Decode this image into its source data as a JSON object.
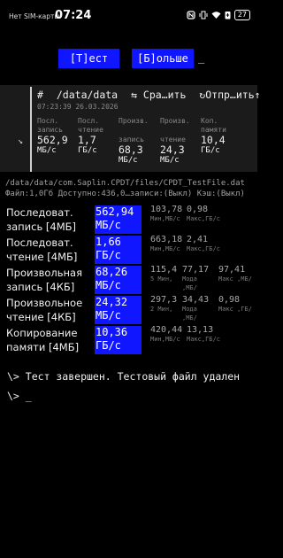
{
  "status": {
    "carrier": "Нет SIM-карты",
    "time": "07:24",
    "icons": [
      "nfc-icon",
      "vibrate-icon",
      "wifi-icon",
      "battery-saver-icon",
      "battery-icon"
    ],
    "battery": "27"
  },
  "buttons": {
    "test": "[Т]ест",
    "more": "[Б]ольше",
    "cursor": "_"
  },
  "panel": {
    "hash": "#",
    "path": "/data/data",
    "compare": "⇆ Сра…ить",
    "send": "↻Отпр…ить↑",
    "timestamp": "07:23:39 26.03.2026",
    "arrow": "↘",
    "stats": [
      {
        "label1": "Посл.",
        "label2": "запись",
        "value": "562,9",
        "unit": "МБ/с"
      },
      {
        "label1": "Посл.",
        "label2": "чтение",
        "value": "1,7",
        "unit": "ГБ/с"
      },
      {
        "label1": "Произв.",
        "label2": "запись",
        "value": "68,3",
        "unit": "МБ/с"
      },
      {
        "label1": "Произв.",
        "label2": "чтение",
        "value": "24,3",
        "unit": "МБ/с"
      },
      {
        "label1": "Коп.",
        "label2": "памяти",
        "value": "10,4",
        "unit": "ГБ/с"
      }
    ]
  },
  "fileinfo": {
    "line1": "/data/data/com.Saplin.CPDT/files/CPDT_TestFile.dat",
    "line2": "Файл:1,0Гб Доступно:436,0…записи:(Выкл) Кэш:(Выкл)"
  },
  "results": [
    {
      "label": "Последоват.\nзапись [4МБ]",
      "value": "562,94",
      "unit": "МБ/с",
      "extra": [
        {
          "v": "103,78",
          "l": "Мин,МБ/с"
        },
        {
          "v": "0,98",
          "l": "Макс,ГБ/с"
        }
      ]
    },
    {
      "label": "Последоват.\nчтение [4МБ]",
      "value": "1,66",
      "unit": "ГБ/с",
      "extra": [
        {
          "v": "663,18",
          "l": "Мин,МБ/с"
        },
        {
          "v": "2,41",
          "l": "Макс,ГБ/с"
        }
      ]
    },
    {
      "label": "Произвольная\nзапись [4КБ]",
      "value": "68,26",
      "unit": "МБ/с",
      "extra": [
        {
          "v": "115,4",
          "l": "5 Мин,"
        },
        {
          "v": "77,17",
          "l": "Мода ,МБ/"
        },
        {
          "v": "97,41",
          "l": "Макс ,МБ/"
        }
      ]
    },
    {
      "label": "Произвольное\nчтение [4КБ]",
      "value": "24,32",
      "unit": "МБ/с",
      "extra": [
        {
          "v": "297,3",
          "l": "2 Мин,"
        },
        {
          "v": "34,43",
          "l": "Мода ,МБ/"
        },
        {
          "v": "0,98",
          "l": "Макс ,ГБ/"
        }
      ]
    },
    {
      "label": "Копирование\nпамяти [4МБ]",
      "value": "10,36",
      "unit": "ГБ/с",
      "extra": [
        {
          "v": "420,44",
          "l": "Мин,МБ/с"
        },
        {
          "v": "13,13",
          "l": "Макс,ГБ/с"
        }
      ]
    }
  ],
  "console": {
    "line1": "\\> Тест завершен. Тестовый файл удален",
    "line2": "\\> _"
  },
  "colors": {
    "accent": "#1016ff",
    "panel": "#1b1b1b",
    "background": "#000000"
  }
}
